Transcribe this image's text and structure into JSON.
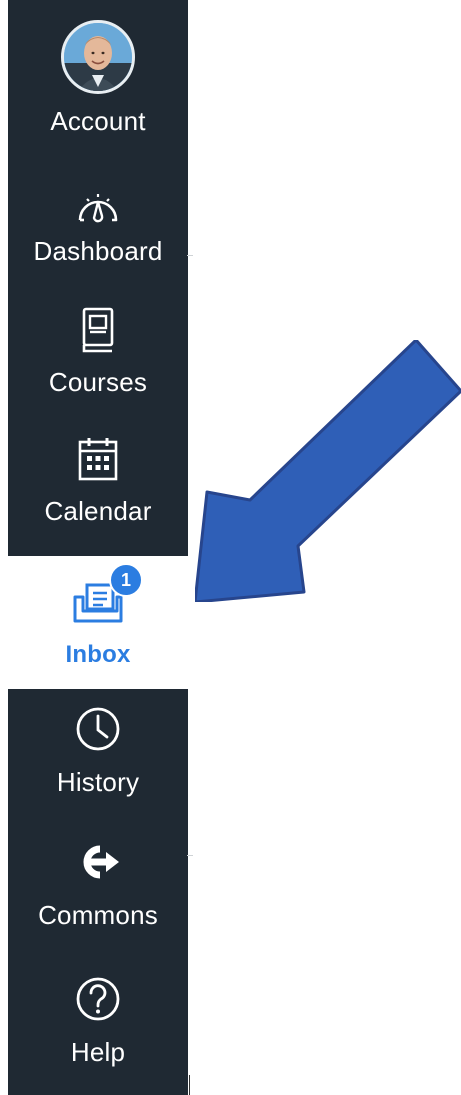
{
  "nav": {
    "items": [
      {
        "label": "Account",
        "icon": "avatar"
      },
      {
        "label": "Dashboard",
        "icon": "speedometer-icon"
      },
      {
        "label": "Courses",
        "icon": "book-icon"
      },
      {
        "label": "Calendar",
        "icon": "calendar-icon"
      },
      {
        "label": "Inbox",
        "icon": "inbox-icon",
        "badge": "1",
        "active": true
      },
      {
        "label": "History",
        "icon": "clock-icon"
      },
      {
        "label": "Commons",
        "icon": "commons-icon"
      },
      {
        "label": "Help",
        "icon": "help-icon"
      }
    ]
  },
  "colors": {
    "sidebar": "#1f2933",
    "active": "#2b7de1",
    "arrow": "#2f5fb7"
  }
}
